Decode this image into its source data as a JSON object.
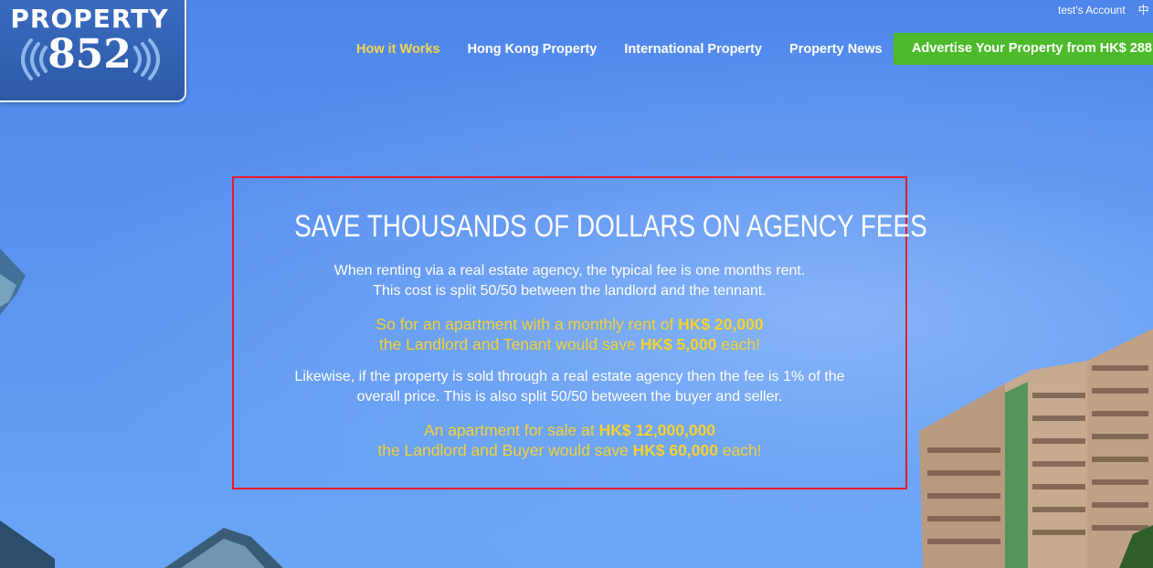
{
  "logo": {
    "title": "PROPERTY",
    "number": "852"
  },
  "utility": {
    "account": "test's Account",
    "lang": "中"
  },
  "nav": {
    "items": [
      {
        "label": "How it Works",
        "active": true
      },
      {
        "label": "Hong Kong Property",
        "active": false
      },
      {
        "label": "International Property",
        "active": false
      },
      {
        "label": "Property News",
        "active": false
      }
    ],
    "cta": "Advertise Your Property from HK$ 288"
  },
  "panel": {
    "headline": "Save Thousands of Dollars on Agency Fees",
    "para1": {
      "line1": "When renting via a real estate agency, the typical fee is one months rent.",
      "line2": "This cost is split 50/50 between the landlord and the tennant."
    },
    "para2": {
      "pre1": "So for an apartment with a monthly rent of ",
      "amount1": "HK$ 20,000",
      "pre2": "the Landlord and Tenant would save ",
      "amount2": "HK$ 5,000",
      "post2": " each!"
    },
    "para3": {
      "line1": "Likewise, if the property is sold through a real estate agency then the fee is 1% of the",
      "line2": "overall price. This is also split 50/50 between the buyer and seller."
    },
    "para4": {
      "pre1": "An apartment for sale at ",
      "amount1": "HK$ 12,000,000",
      "pre2": "the Landlord and Buyer would save ",
      "amount2": "HK$ 60,000",
      "post2": " each!"
    }
  },
  "colors": {
    "accent_yellow": "#f6d22e",
    "cta_green": "#4cba2a",
    "highlight_border": "#e81a2c",
    "sky": "#5b93f0"
  }
}
